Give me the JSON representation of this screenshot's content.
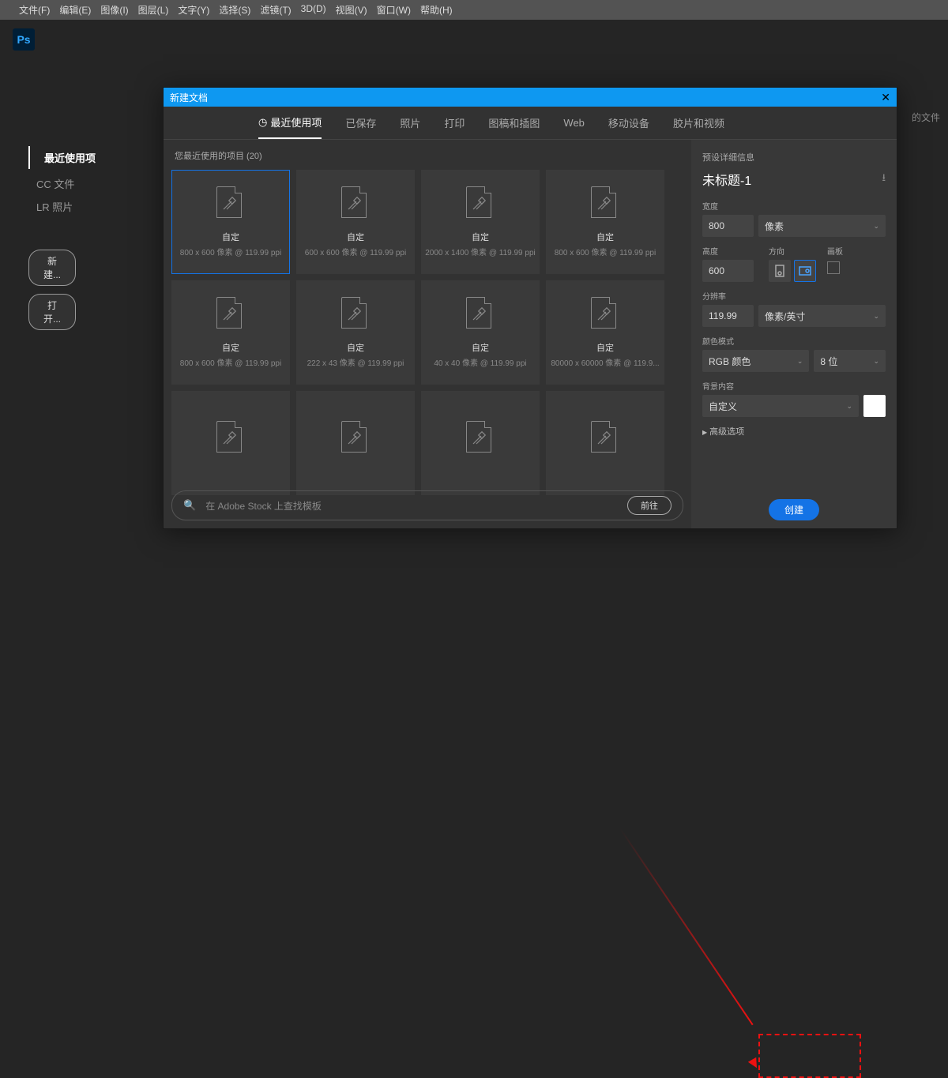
{
  "menubar": [
    "文件(F)",
    "编辑(E)",
    "图像(I)",
    "图层(L)",
    "文字(Y)",
    "选择(S)",
    "滤镜(T)",
    "3D(D)",
    "视图(V)",
    "窗口(W)",
    "帮助(H)"
  ],
  "logo": "Ps",
  "home": {
    "nav": [
      "最近使用项",
      "CC 文件",
      "LR 照片"
    ],
    "btn_new": "新建...",
    "btn_open": "打开...",
    "bgtext": "的文件"
  },
  "dialog": {
    "title": "新建文档",
    "tabs": [
      "最近使用项",
      "已保存",
      "照片",
      "打印",
      "图稿和插图",
      "Web",
      "移动设备",
      "胶片和视频"
    ],
    "section": "您最近使用的项目  (20)",
    "search_placeholder": "在 Adobe Stock 上查找模板",
    "go": "前往",
    "cards": [
      {
        "t": "自定",
        "m": "800 x 600 像素 @ 119.99 ppi",
        "sel": true
      },
      {
        "t": "自定",
        "m": "600 x 600 像素 @ 119.99 ppi"
      },
      {
        "t": "自定",
        "m": "2000 x 1400 像素 @ 119.99 ppi"
      },
      {
        "t": "自定",
        "m": "800 x 600 像素 @ 119.99 ppi"
      },
      {
        "t": "自定",
        "m": "800 x 600 像素 @ 119.99 ppi"
      },
      {
        "t": "自定",
        "m": "222 x 43 像素 @ 119.99 ppi"
      },
      {
        "t": "自定",
        "m": "40 x 40 像素 @ 119.99 ppi"
      },
      {
        "t": "自定",
        "m": "80000 x 60000 像素 @ 119.9..."
      },
      {
        "t": "",
        "m": ""
      },
      {
        "t": "",
        "m": ""
      },
      {
        "t": "",
        "m": ""
      },
      {
        "t": "",
        "m": ""
      }
    ]
  },
  "details": {
    "header": "预设详细信息",
    "doc_name": "未标题-1",
    "width_label": "宽度",
    "width_value": "800",
    "unit": "像素",
    "height_label": "高度",
    "height_value": "600",
    "orient_label": "方向",
    "artboard_label": "画板",
    "res_label": "分辨率",
    "res_value": "119.99",
    "res_unit": "像素/英寸",
    "mode_label": "颜色模式",
    "mode_value": "RGB 颜色",
    "bits": "8 位",
    "bg_label": "背景内容",
    "bg_value": "自定义",
    "advanced": "高级选项",
    "create": "创建"
  }
}
